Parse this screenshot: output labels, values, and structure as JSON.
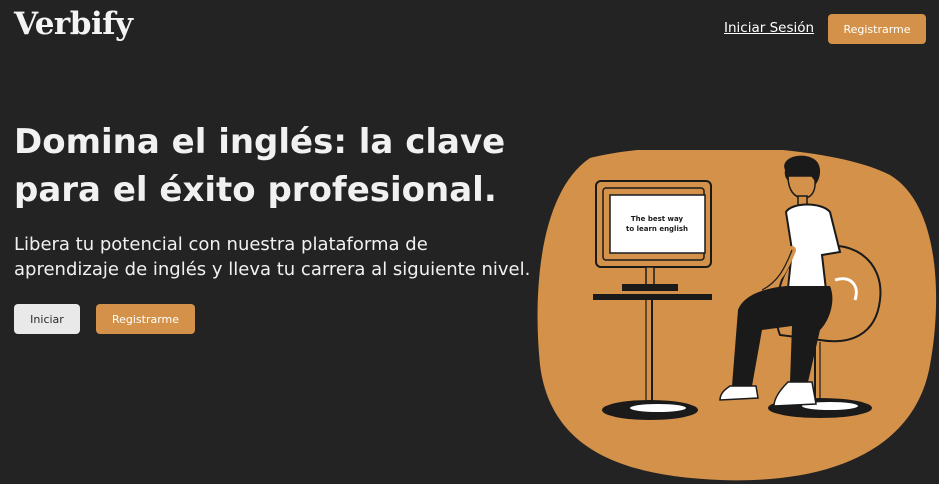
{
  "brand": {
    "logo": "Verbify"
  },
  "nav": {
    "login_label": "Iniciar Sesión",
    "register_label": "Registrarme"
  },
  "hero": {
    "title_line1": "Domina el inglés: la clave",
    "title_line2": "para el éxito profesional.",
    "subtitle_line1": "Libera tu potencial con nuestra plataforma de",
    "subtitle_line2": "aprendizaje de inglés y lleva tu carrera al siguiente nivel.",
    "start_label": "Iniciar",
    "register_label": "Registrarme"
  },
  "illustration": {
    "screen_line1": "The best way",
    "screen_line2": "to learn english",
    "blob_color": "#d4914a"
  },
  "colors": {
    "background": "#232323",
    "accent": "#d4914a",
    "light_button": "#e9e9e9"
  }
}
